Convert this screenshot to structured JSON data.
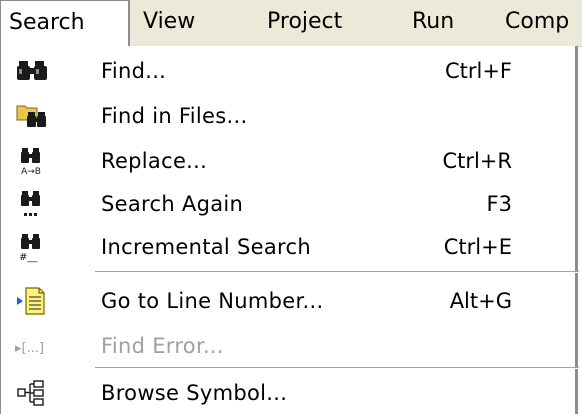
{
  "menubar": {
    "items": [
      {
        "label": "Search",
        "open": true
      },
      {
        "label": "View"
      },
      {
        "label": "Project"
      },
      {
        "label": "Run"
      },
      {
        "label": "Comp"
      }
    ]
  },
  "search_menu": {
    "items": [
      {
        "label": "Find...",
        "shortcut": "Ctrl+F",
        "icon": "binoculars-icon"
      },
      {
        "label": "Find in Files...",
        "shortcut": "",
        "icon": "find-in-files-icon"
      },
      {
        "label": "Replace...",
        "shortcut": "Ctrl+R",
        "icon": "replace-icon"
      },
      {
        "label": "Search Again",
        "shortcut": "F3",
        "icon": "search-again-icon"
      },
      {
        "label": "Incremental Search",
        "shortcut": "Ctrl+E",
        "icon": "incremental-search-icon"
      },
      {
        "label": "Go to Line Number...",
        "shortcut": "Alt+G",
        "icon": "goto-line-icon"
      },
      {
        "label": "Find Error...",
        "shortcut": "",
        "icon": "find-error-icon",
        "disabled": true
      },
      {
        "label": "Browse Symbol...",
        "shortcut": "",
        "icon": "browse-symbol-icon"
      }
    ]
  },
  "icon_labels": {
    "replace_caption": "A→B",
    "incremental_caption": "#__",
    "find_error_caption": "▸[...]"
  },
  "colors": {
    "menubar_bg": "#ece9d8",
    "disabled_text": "#a0a0a0",
    "border": "#8c8c8c"
  }
}
